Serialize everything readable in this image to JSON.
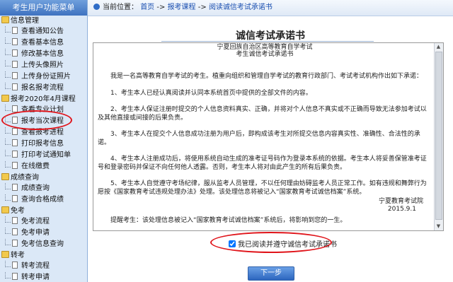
{
  "sidebar": {
    "header": "考生用户功能菜单",
    "groups": [
      {
        "label": "信息管理",
        "items": [
          "查看通知公告",
          "查看基本信息",
          "修改基本信息",
          "上传头像照片",
          "上传身份证照片",
          "报名报考流程"
        ]
      },
      {
        "label": "报考2020年4月课程",
        "items": [
          "查看专业计划",
          "报考当次课程",
          "查看报考进程",
          "打印报考信息",
          "打印考试通知单",
          "在线缴费"
        ]
      },
      {
        "label": "成绩查询",
        "items": [
          "成绩查询",
          "查询合格成绩"
        ]
      },
      {
        "label": "免考",
        "items": [
          "免考流程",
          "免考申请",
          "免考信息查询"
        ]
      },
      {
        "label": "转考",
        "items": [
          "转考流程",
          "转考申请"
        ]
      }
    ]
  },
  "topbar": {
    "prefix": "当前位置：",
    "home": "首页",
    "sep": "->",
    "crumb1": "报考课程",
    "current": "阅读诚信考试承诺书"
  },
  "main": {
    "title": "诚信考试承诺书",
    "doc": {
      "head1": "宁夏回族自治区高等教育自学考试",
      "head2": "考生诚信考试承诺书",
      "paragraphs": [
        "我是一名高等教育自学考试的考生。植重向组织和管理自学考试的教育行政部门、考试考试机构作出如下承诺：",
        "1、考生本人已经认真阅读并认同本系统首页中提供的全部文件的内容。",
        "2、考生本人保证注册时提交的个人信息资料真实、正确，并将对个人信息不真实或不正确而导致无法参加考试以及其他直接或间接的后果负责。",
        "3、考生本人在提交个人信息成功注册为用户后，即构成该考生对所提交信息内容真实性、准确性、合法性的承诺。",
        "4、考生本人注册成功后，将使用系统自动生成的准考证号码作为登录本系统的依据。考生本人将妥善保管准考证号和登录密码并保证不向任何他人透露。否则，考生本人将对由此产生的所有后果负责。",
        "5、考生本人自觉遵守考场纪律，服从监考人员管理，不以任何理由妨碍监考人员正常工作。如有违规和舞弊行为愿按《国家教育考试违规处理办法》处理。该处理信息将被记入“国家教育考试诚信档案”系统。"
      ],
      "org": "宁夏教育考试院",
      "date": "2015.9.1",
      "reminder": "提醒考生：该处理信息被记入“国家教育考试诚信档案”系统后，将影响到您的一生。"
    },
    "agree_label": "我已阅读并遵守诚信考试承诺书",
    "agree_checked": true,
    "next_label": "下一步"
  }
}
